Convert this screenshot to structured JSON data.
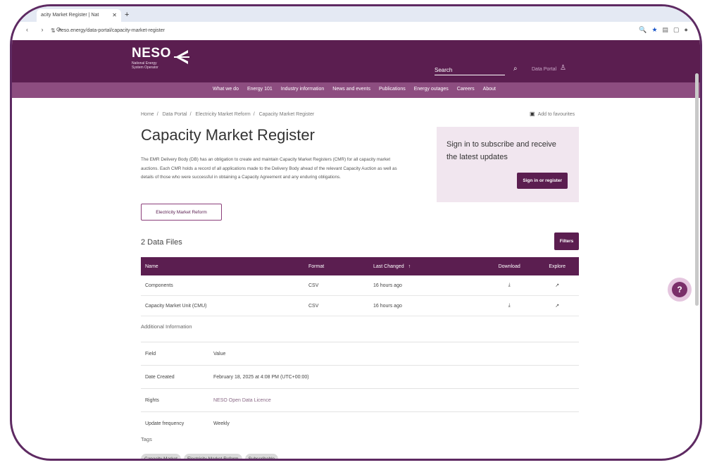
{
  "browser": {
    "tab_title": "acity Market Register | Nat",
    "tab_close": "✕",
    "new_tab": "+",
    "url": "neso.energy/data-portal/capacity-market-register",
    "nav_buttons": "‹ › ⟳",
    "tune_icon": "⇅"
  },
  "header": {
    "logo_word": "NESO",
    "logo_sub": "National Energy System Operator",
    "search_label": "Search",
    "data_portal": "Data Portal"
  },
  "nav": {
    "items": [
      "What we do",
      "Energy 101",
      "Industry information",
      "News and events",
      "Publications",
      "Energy outages",
      "Careers",
      "About"
    ]
  },
  "breadcrumb": [
    "Home",
    "Data Portal",
    "Electricity Market Reform",
    "Capacity Market Register"
  ],
  "favourites_label": "Add to favourites",
  "page_title": "Capacity Market Register",
  "intro": "The EMR Delivery Body (DB) has an obligation to create and maintain Capacity Market Registers (CMR) for all capacity market auctions. Each CMR holds a record of all applications made to the Delivery Body ahead of the relevant Capacity Auction as well as details of those who were successful in obtaining a Capacity Agreement and any enduring obligations.",
  "tag_button": "Electricity Market Reform",
  "signin": {
    "text": "Sign in to subscribe and receive the latest updates",
    "button": "Sign in or register"
  },
  "files": {
    "title": "2 Data Files",
    "filters_label": "Filters",
    "columns": {
      "name": "Name",
      "format": "Format",
      "last_changed": "Last Changed",
      "download": "Download",
      "explore": "Explore"
    },
    "sort_arrow": "↑",
    "rows": [
      {
        "name": "Components",
        "format": "CSV",
        "changed": "16 hours ago"
      },
      {
        "name": "Capacity Market Unit (CMU)",
        "format": "CSV",
        "changed": "16 hours ago"
      }
    ]
  },
  "additional": {
    "title": "Additional Information",
    "rows": [
      {
        "field": "Field",
        "value": "Value"
      },
      {
        "field": "Date Created",
        "value": "February 18, 2025 at 4:08 PM (UTC+00:00)"
      },
      {
        "field": "Rights",
        "value": "NESO Open Data Licence"
      },
      {
        "field": "Update frequency",
        "value": "Weekly"
      }
    ]
  },
  "tags": {
    "title": "Tags",
    "items": [
      "Capacity Market",
      "Electricity Market Reform",
      "Subscribable"
    ]
  },
  "help_label": "?"
}
